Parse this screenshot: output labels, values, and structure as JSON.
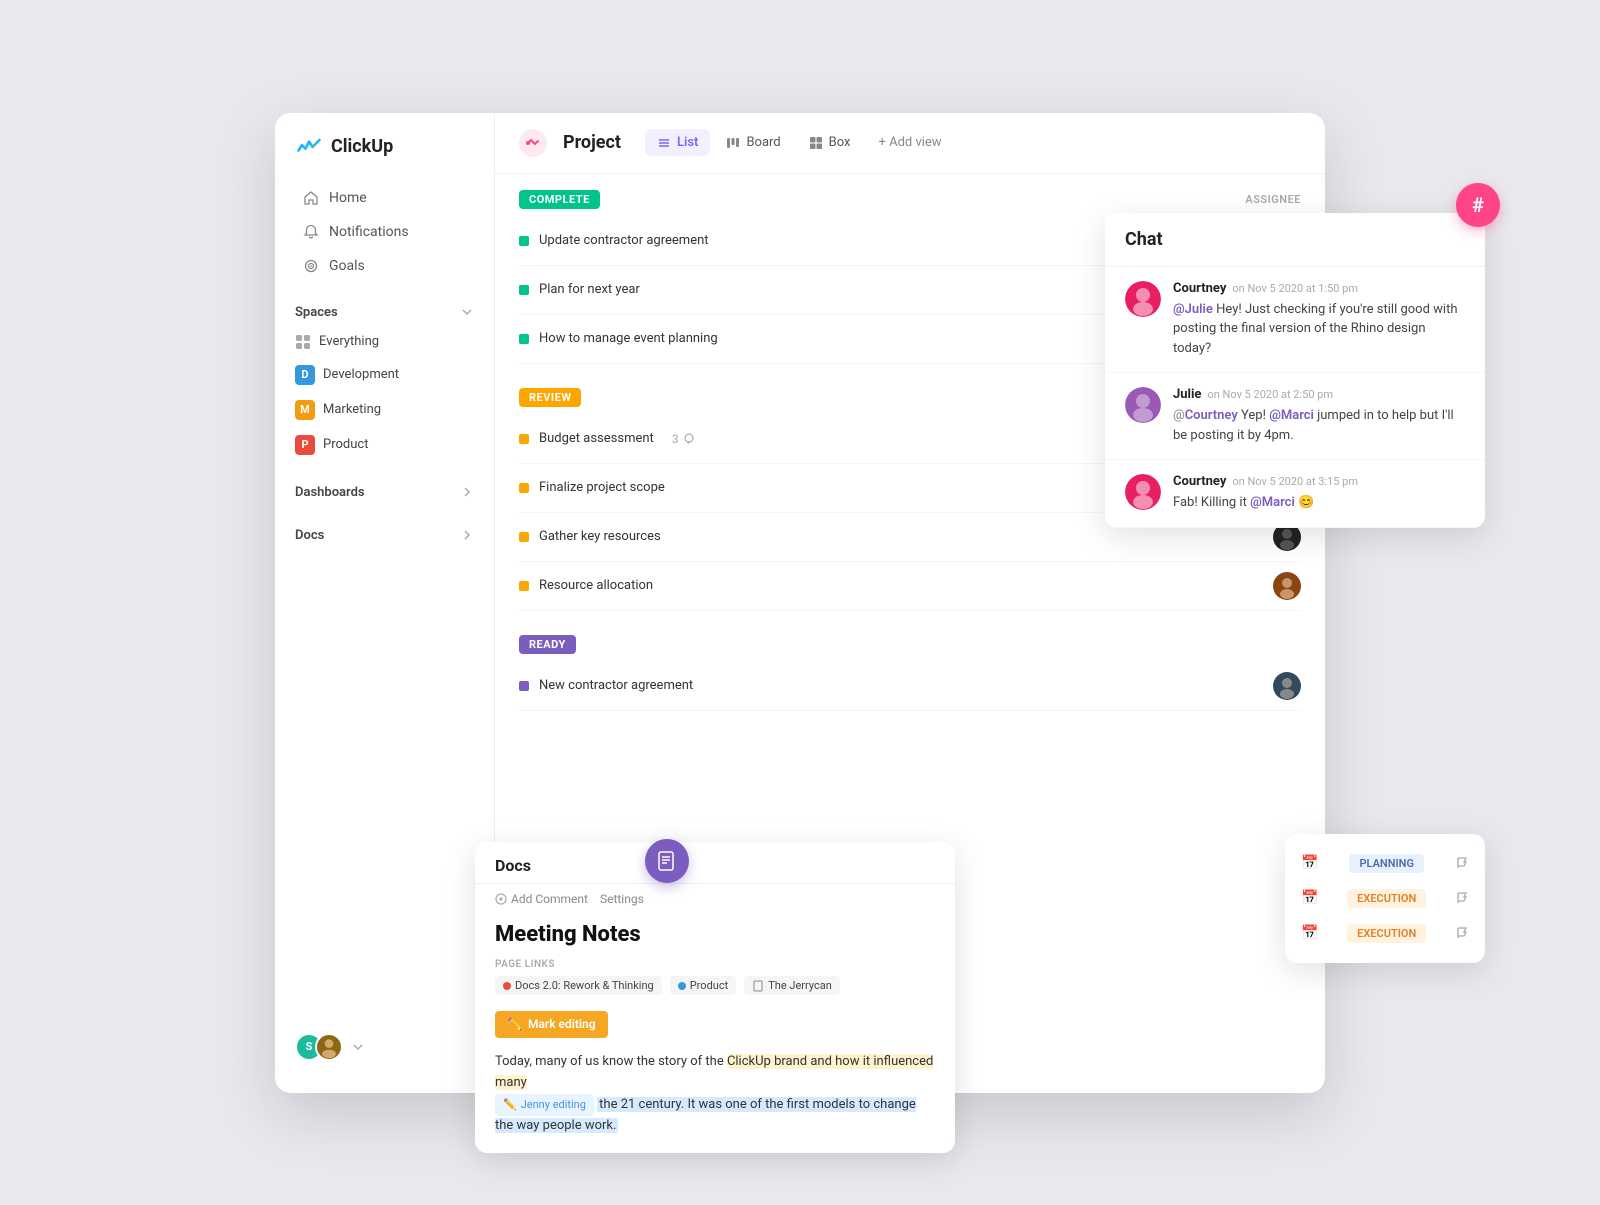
{
  "app": {
    "name": "ClickUp"
  },
  "sidebar": {
    "nav": [
      {
        "id": "home",
        "label": "Home",
        "icon": "home"
      },
      {
        "id": "notifications",
        "label": "Notifications",
        "icon": "bell"
      },
      {
        "id": "goals",
        "label": "Goals",
        "icon": "flag"
      }
    ],
    "spaces_label": "Spaces",
    "spaces": [
      {
        "id": "everything",
        "label": "Everything",
        "icon": "grid",
        "color": ""
      },
      {
        "id": "development",
        "label": "Development",
        "initial": "D",
        "color": "#3498db"
      },
      {
        "id": "marketing",
        "label": "Marketing",
        "initial": "M",
        "color": "#f39c12"
      },
      {
        "id": "product",
        "label": "Product",
        "initial": "P",
        "color": "#e74c3c"
      }
    ],
    "dashboards_label": "Dashboards",
    "docs_label": "Docs"
  },
  "project": {
    "title": "Project",
    "views": [
      {
        "id": "list",
        "label": "List",
        "active": true
      },
      {
        "id": "board",
        "label": "Board",
        "active": false
      },
      {
        "id": "box",
        "label": "Box",
        "active": false
      }
    ],
    "add_view_label": "+ Add view",
    "assignee_header": "ASSIGNEE"
  },
  "task_sections": [
    {
      "id": "complete",
      "status": "COMPLETE",
      "status_class": "status-complete",
      "tasks": [
        {
          "id": 1,
          "name": "Update contractor agreement",
          "indicator": "ind-green",
          "avatar_color": "#9b59b6"
        },
        {
          "id": 2,
          "name": "Plan for next year",
          "indicator": "ind-green",
          "avatar_color": "#e91e63"
        },
        {
          "id": 3,
          "name": "How to manage event planning",
          "indicator": "ind-green",
          "avatar_color": "#2ecc71"
        }
      ]
    },
    {
      "id": "review",
      "status": "REVIEW",
      "status_class": "status-review",
      "tasks": [
        {
          "id": 4,
          "name": "Budget assessment",
          "indicator": "ind-orange",
          "comment_count": 3,
          "avatar_color": "#34495e"
        },
        {
          "id": 5,
          "name": "Finalize project scope",
          "indicator": "ind-orange",
          "avatar_color": "#555"
        },
        {
          "id": 6,
          "name": "Gather key resources",
          "indicator": "ind-orange",
          "avatar_color": "#222"
        },
        {
          "id": 7,
          "name": "Resource allocation",
          "indicator": "ind-orange",
          "avatar_color": "#8b4513"
        }
      ]
    },
    {
      "id": "ready",
      "status": "READY",
      "status_class": "status-ready",
      "tasks": [
        {
          "id": 8,
          "name": "New contractor agreement",
          "indicator": "ind-blue",
          "avatar_color": "#34495e"
        }
      ]
    }
  ],
  "chat": {
    "title": "Chat",
    "messages": [
      {
        "id": 1,
        "author": "Courtney",
        "time": "on Nov 5 2020 at 1:50 pm",
        "avatar_color": "#e91e63",
        "text_parts": [
          {
            "type": "mention",
            "text": "@Julie"
          },
          {
            "type": "plain",
            "text": " Hey! Just checking if you're still good with posting the final version of the Rhino design today?"
          }
        ]
      },
      {
        "id": 2,
        "author": "Julie",
        "time": "on Nov 5 2020 at 2:50 pm",
        "avatar_color": "#9b59b6",
        "text_parts": [
          {
            "type": "at",
            "text": "@"
          },
          {
            "type": "mention",
            "text": "Courtney"
          },
          {
            "type": "plain",
            "text": " Yep! "
          },
          {
            "type": "mention",
            "text": "@Marci"
          },
          {
            "type": "plain",
            "text": " jumped in to help but I'll be posting it by 4pm."
          }
        ]
      },
      {
        "id": 3,
        "author": "Courtney",
        "time": "on Nov 5 2020 at 3:15 pm",
        "avatar_color": "#e91e63",
        "text_parts": [
          {
            "type": "plain",
            "text": "Fab! Killing it "
          },
          {
            "type": "mention",
            "text": "@Marci"
          },
          {
            "type": "plain",
            "text": " 😊"
          }
        ]
      }
    ]
  },
  "docs": {
    "title": "Docs",
    "toolbar": {
      "add_comment": "Add Comment",
      "settings": "Settings"
    },
    "doc_title": "Meeting Notes",
    "page_links_label": "PAGE LINKS",
    "page_links": [
      {
        "label": "Docs 2.0: Rework & Thinking",
        "color": "#e74c3c"
      },
      {
        "label": "Product",
        "color": "#3498db"
      },
      {
        "label": "The Jerrycan",
        "color": "#888"
      }
    ],
    "content": "Today, many of us know the story of the ClickUp brand and how it influenced many the 21 century. It was one of the first models to change the way people work.",
    "mark_editing": "Mark editing",
    "jenny_editing": "Jenny editing"
  },
  "tags": [
    {
      "icon": "calendar",
      "label": "PLANNING",
      "class": "tag-planning"
    },
    {
      "icon": "calendar",
      "label": "EXECUTION",
      "class": "tag-execution"
    },
    {
      "icon": "calendar",
      "label": "EXECUTION",
      "class": "tag-execution"
    }
  ]
}
